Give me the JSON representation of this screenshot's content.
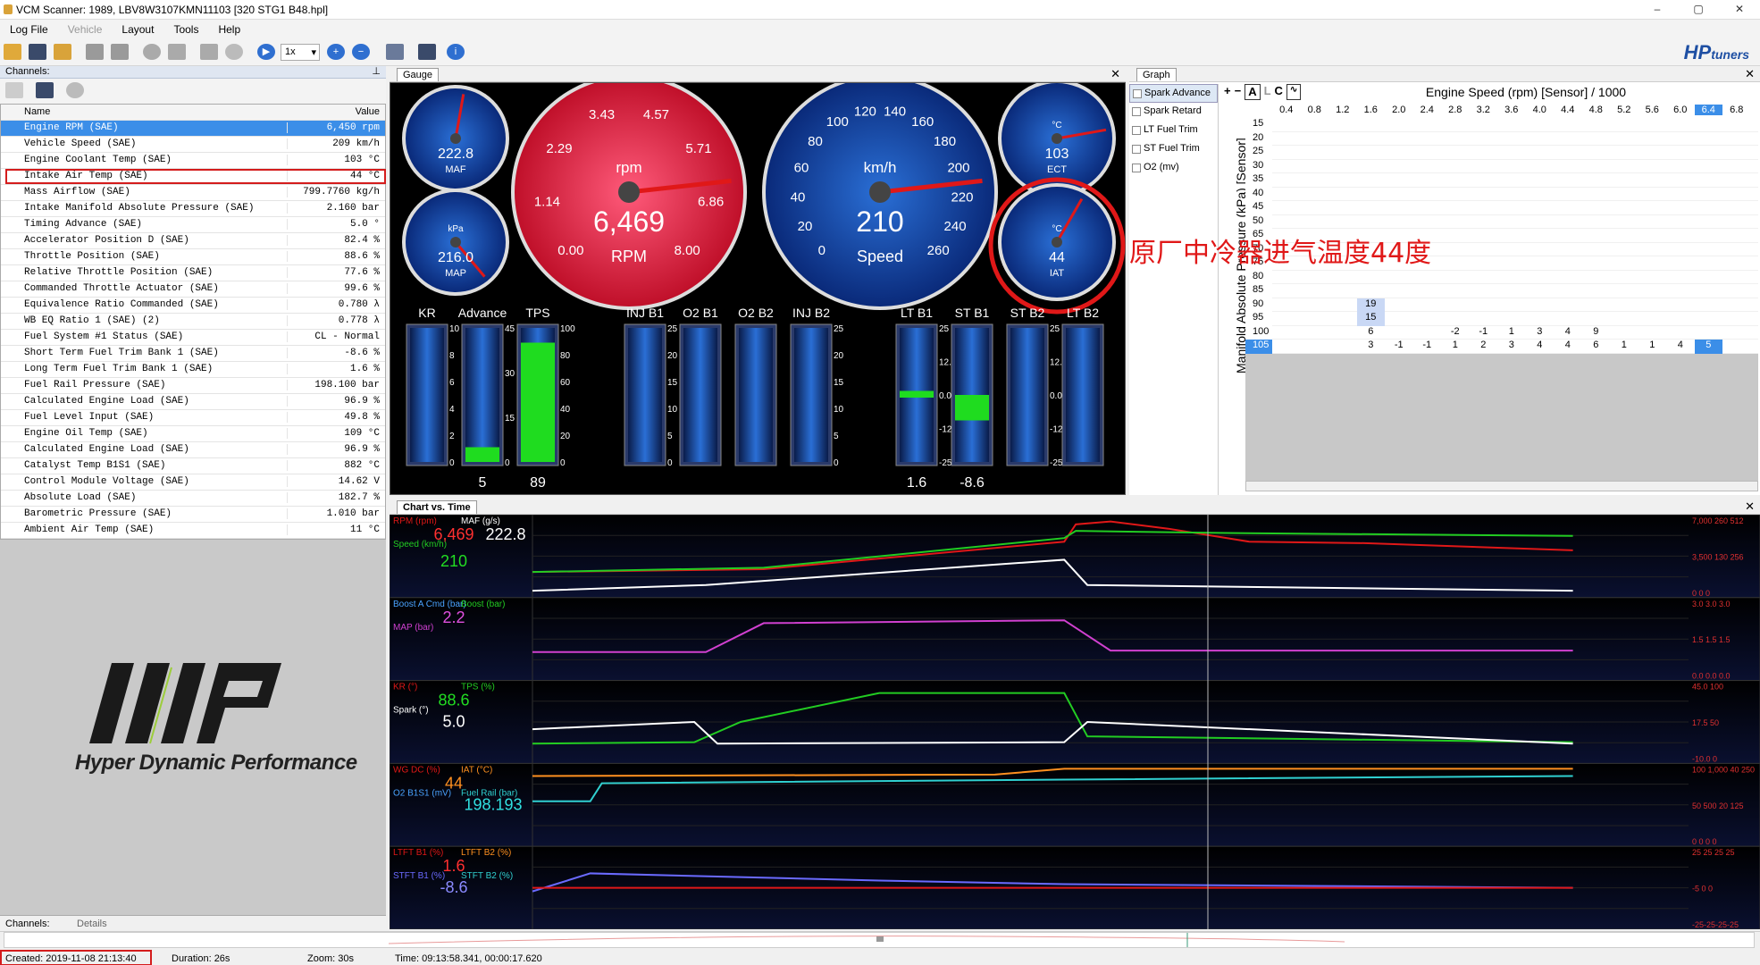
{
  "window": {
    "title": "VCM Scanner: 1989, LBV8W3107KMN11103 [320 STG1 B48.hpl]",
    "min": "–",
    "restore": "▢",
    "close": "✕"
  },
  "menu": [
    "Log File",
    "Vehicle",
    "Layout",
    "Tools",
    "Help"
  ],
  "toolbar": {
    "speed_select": "1x",
    "brand": "HP",
    "brand_sub": "tuners"
  },
  "channels": {
    "header": "Channels:",
    "col_name": "Name",
    "col_value": "Value",
    "rows": [
      {
        "name": "Engine RPM (SAE)",
        "value": "6,450 rpm"
      },
      {
        "name": "Vehicle Speed (SAE)",
        "value": "209 km/h"
      },
      {
        "name": "Engine Coolant Temp (SAE)",
        "value": "103 °C"
      },
      {
        "name": "Intake Air Temp (SAE)",
        "value": "44 °C"
      },
      {
        "name": "Mass Airflow (SAE)",
        "value": "799.7760 kg/h"
      },
      {
        "name": "Intake Manifold Absolute Pressure (SAE)",
        "value": "2.160 bar"
      },
      {
        "name": "Timing Advance (SAE)",
        "value": "5.0 °"
      },
      {
        "name": "Accelerator Position D (SAE)",
        "value": "82.4 %"
      },
      {
        "name": "Throttle Position (SAE)",
        "value": "88.6 %"
      },
      {
        "name": "Relative Throttle Position (SAE)",
        "value": "77.6 %"
      },
      {
        "name": "Commanded Throttle Actuator (SAE)",
        "value": "99.6 %"
      },
      {
        "name": "Equivalence Ratio Commanded (SAE)",
        "value": "0.780 λ"
      },
      {
        "name": "WB EQ Ratio 1 (SAE) (2)",
        "value": "0.778 λ"
      },
      {
        "name": "Fuel System #1 Status (SAE)",
        "value": "CL - Normal"
      },
      {
        "name": "Short Term Fuel Trim Bank 1 (SAE)",
        "value": "-8.6 %"
      },
      {
        "name": "Long Term Fuel Trim Bank 1 (SAE)",
        "value": "1.6 %"
      },
      {
        "name": "Fuel Rail Pressure (SAE)",
        "value": "198.100 bar"
      },
      {
        "name": "Calculated Engine Load (SAE)",
        "value": "96.9 %"
      },
      {
        "name": "Fuel Level Input (SAE)",
        "value": "49.8 %"
      },
      {
        "name": "Engine Oil Temp (SAE)",
        "value": "109 °C"
      },
      {
        "name": "Calculated Engine Load (SAE)",
        "value": "96.9 %"
      },
      {
        "name": "Catalyst Temp B1S1 (SAE)",
        "value": "882 °C"
      },
      {
        "name": "Control Module Voltage (SAE)",
        "value": "14.62 V"
      },
      {
        "name": "Absolute Load (SAE)",
        "value": "182.7 %"
      },
      {
        "name": "Barometric Pressure (SAE)",
        "value": "1.010 bar"
      },
      {
        "name": "Ambient Air Temp (SAE)",
        "value": "11 °C"
      }
    ],
    "logo_text": "Hyper Dynamic Performance",
    "tab_channels": "Channels:",
    "tab_details": "Details"
  },
  "gauge_panel": {
    "tab": "Gauge",
    "maf": {
      "value": "222.8",
      "label": "MAF"
    },
    "map": {
      "value": "216.0",
      "unit": "kPa",
      "label": "MAP"
    },
    "rpm": {
      "value": "6,469",
      "unit": "rpm",
      "label": "RPM",
      "ticks": [
        "0.00",
        "1.14",
        "2.29",
        "3.43",
        "4.57",
        "5.71",
        "6.86",
        "8.00"
      ],
      "fraction": 0.81
    },
    "speed": {
      "value": "210",
      "unit": "km/h",
      "label": "Speed",
      "ticks": [
        "0",
        "20",
        "40",
        "60",
        "80",
        "100",
        "120",
        "140",
        "160",
        "180",
        "200",
        "220",
        "240",
        "260"
      ],
      "fraction": 0.81
    },
    "ect": {
      "value": "103",
      "unit": "°C",
      "label": "ECT"
    },
    "iat": {
      "value": "44",
      "unit": "°C",
      "label": "IAT"
    },
    "annotation": "原厂中冷器进气温度44度",
    "bars": [
      {
        "label": "KR",
        "value": "",
        "scale": [
          "10",
          "8",
          "6",
          "4",
          "2",
          "0"
        ],
        "fill": 0.0
      },
      {
        "label": "Advance",
        "value": "5",
        "scale": [
          "45",
          "30",
          "15",
          "0"
        ],
        "fill": 0.11
      },
      {
        "label": "TPS",
        "value": "89",
        "scale": [
          "100",
          "80",
          "60",
          "40",
          "20",
          "0"
        ],
        "fill": 0.89
      },
      {
        "label": "INJ B1",
        "value": "",
        "scale": [
          "25",
          "20",
          "15",
          "10",
          "5",
          "0"
        ],
        "fill": 0.0
      },
      {
        "label": "O2 B1",
        "value": "",
        "scale": [],
        "fill": 0.0
      },
      {
        "label": "O2 B2",
        "value": "",
        "scale": [],
        "fill": 0.0
      },
      {
        "label": "INJ B2",
        "value": "",
        "scale": [
          "25",
          "20",
          "15",
          "10",
          "5",
          "0"
        ],
        "fill": 0.0
      },
      {
        "label": "LT B1",
        "value": "1.6",
        "scale": [
          "25",
          "12.5",
          "0.0",
          "-12",
          "-25"
        ],
        "fill": 0.53
      },
      {
        "label": "ST B1",
        "value": "-8.6",
        "scale": [],
        "fill": 0.33
      },
      {
        "label": "ST B2",
        "value": "",
        "scale": [
          "25",
          "12.5",
          "0.0",
          "-12",
          "-25"
        ],
        "fill": 0.0
      },
      {
        "label": "LT B2",
        "value": "",
        "scale": [],
        "fill": 0.0
      }
    ]
  },
  "graph_panel": {
    "tab": "Graph",
    "list": [
      "Spark Advance",
      "Spark Retard",
      "LT Fuel Trim",
      "ST Fuel Trim",
      "O2 (mv)"
    ],
    "toolbar": [
      "+",
      "−",
      "A",
      "L",
      "C"
    ],
    "title": "Engine Speed (rpm) [Sensor] / 1000",
    "y_axis_label": "Manifold Absolute Pressure (kPa) [Sensor]",
    "cols": [
      "0.4",
      "0.8",
      "1.2",
      "1.6",
      "2.0",
      "2.4",
      "2.8",
      "3.2",
      "3.6",
      "4.0",
      "4.4",
      "4.8",
      "5.2",
      "5.6",
      "6.0",
      "6.4",
      "6.8"
    ],
    "rows": [
      {
        "y": "15",
        "cells": []
      },
      {
        "y": "20",
        "cells": []
      },
      {
        "y": "25",
        "cells": []
      },
      {
        "y": "30",
        "cells": []
      },
      {
        "y": "35",
        "cells": []
      },
      {
        "y": "40",
        "cells": []
      },
      {
        "y": "45",
        "cells": []
      },
      {
        "y": "50",
        "cells": []
      },
      {
        "y": "65",
        "cells": []
      },
      {
        "y": "70",
        "cells": []
      },
      {
        "y": "75",
        "cells": []
      },
      {
        "y": "80",
        "cells": []
      },
      {
        "y": "85",
        "cells": []
      },
      {
        "y": "90",
        "cells": [
          "",
          "",
          "",
          "19"
        ]
      },
      {
        "y": "95",
        "cells": [
          "",
          "",
          "",
          "15"
        ]
      },
      {
        "y": "100",
        "cells": [
          "",
          "",
          "",
          "6",
          "",
          "",
          "-2",
          "-1",
          "1",
          "3",
          "4",
          "9"
        ]
      },
      {
        "y": "105",
        "cells": [
          "",
          "",
          "",
          "3",
          "-1",
          "-1",
          "1",
          "2",
          "3",
          "4",
          "4",
          "6",
          "1",
          "1",
          "4",
          "5"
        ]
      }
    ]
  },
  "chart_panel": {
    "tab": "Chart vs. Time",
    "lanes": [
      {
        "labels": [
          {
            "t": "RPM (rpm)",
            "c": "#e01818"
          },
          {
            "t": "MAF (g/s)",
            "c": "#ffffff"
          },
          {
            "t": "Speed (km/h)",
            "c": "#22cc22"
          }
        ],
        "values": [
          {
            "t": "6,469",
            "c": "#ff3030"
          },
          {
            "t": "222.8",
            "c": "#ffffff"
          },
          {
            "t": "210",
            "c": "#22dd22"
          }
        ],
        "scale": [
          "7,000 260 512",
          "3,500 130 256",
          "0 0 0"
        ]
      },
      {
        "labels": [
          {
            "t": "Boost A Cmd (bar)",
            "c": "#4aa3ff"
          },
          {
            "t": "Boost (bar)",
            "c": "#22cc22"
          },
          {
            "t": "MAP (bar)",
            "c": "#d040d0"
          }
        ],
        "values": [
          {
            "t": "2.2",
            "c": "#e050e0"
          }
        ],
        "scale": [
          "3.0 3.0 3.0",
          "1.5 1.5 1.5",
          "0.0 0.0 0.0"
        ]
      },
      {
        "labels": [
          {
            "t": "KR (°)",
            "c": "#e01818"
          },
          {
            "t": "TPS (%)",
            "c": "#22cc22"
          },
          {
            "t": "Spark (°)",
            "c": "#ffffff"
          }
        ],
        "values": [
          {
            "t": "88.6",
            "c": "#22dd22"
          },
          {
            "t": "5.0",
            "c": "#ffffff"
          }
        ],
        "scale": [
          "45.0 100",
          "17.5 50",
          "-10.0 0"
        ]
      },
      {
        "labels": [
          {
            "t": "WG DC (%)",
            "c": "#e01818"
          },
          {
            "t": "IAT (°C)",
            "c": "#ff9020"
          },
          {
            "t": "O2 B1S1 (mV)",
            "c": "#4aa3ff"
          },
          {
            "t": "Fuel Rail (bar)",
            "c": "#30d0d0"
          }
        ],
        "values": [
          {
            "t": "44",
            "c": "#ff9020"
          },
          {
            "t": "198.193",
            "c": "#30e0e0"
          }
        ],
        "scale": [
          "100 1,000 40 250",
          "50 500 20 125",
          "0 0 0 0"
        ]
      },
      {
        "labels": [
          {
            "t": "LTFT B1 (%)",
            "c": "#e01818"
          },
          {
            "t": "LTFT B2 (%)",
            "c": "#ff9020"
          },
          {
            "t": "STFT B1 (%)",
            "c": "#6a6aff"
          },
          {
            "t": "STFT B2 (%)",
            "c": "#30d0d0"
          }
        ],
        "values": [
          {
            "t": "1.6",
            "c": "#ff3030"
          },
          {
            "t": "-8.6",
            "c": "#8a8aff"
          }
        ],
        "scale": [
          "25 25 25 25",
          "-5 0 0",
          "-25-25-25-25"
        ]
      }
    ]
  },
  "status": {
    "created": "Created: 2019-11-08 21:13:40",
    "duration": "Duration: 26s",
    "zoom": "Zoom: 30s",
    "time": "Time: 09:13:58.341, 00:00:17.620"
  }
}
